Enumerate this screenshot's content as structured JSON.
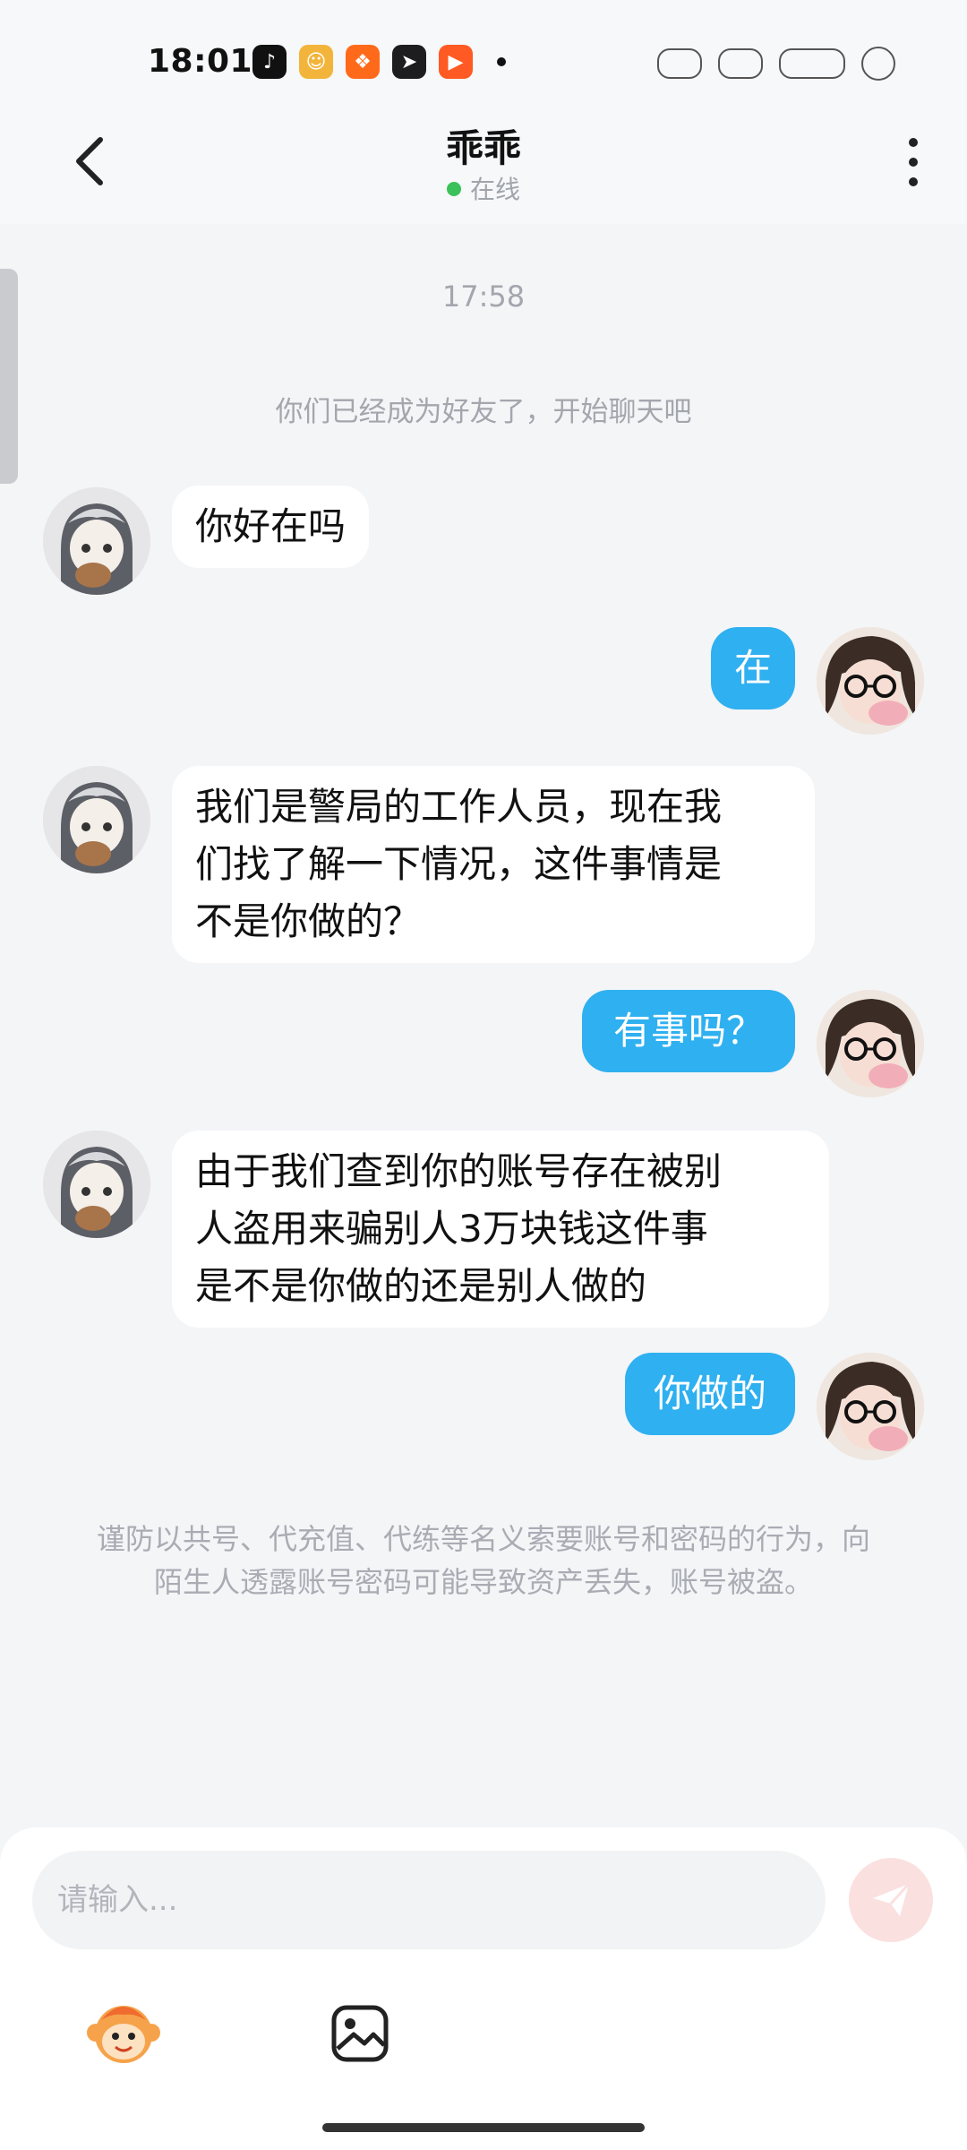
{
  "status_bar": {
    "time": "18:01",
    "apps": [
      {
        "icon": "tiktok-icon",
        "color": "#111111",
        "glyph": "♪"
      },
      {
        "icon": "game-icon",
        "color": "#f2b43a",
        "glyph": "☺"
      },
      {
        "icon": "kuaishou-icon",
        "color": "#ff6a1a",
        "glyph": "❖"
      },
      {
        "icon": "arrow-app-icon",
        "color": "#1d1d1f",
        "glyph": "➤"
      },
      {
        "icon": "video-app-icon",
        "color": "#ff5a24",
        "glyph": "▶"
      }
    ]
  },
  "header": {
    "title": "乖乖",
    "status": "在线",
    "status_color": "#3bc15a"
  },
  "chat": {
    "timestamp": "17:58",
    "system_notice": "你们已经成为好友了，开始聊天吧",
    "messages": [
      {
        "side": "left",
        "text": "你好在吗"
      },
      {
        "side": "right",
        "text": "在"
      },
      {
        "side": "left",
        "text": "我们是警局的工作人员，现在我\n们找了解一下情况，这件事情是\n不是你做的？"
      },
      {
        "side": "right",
        "text": "有事吗？"
      },
      {
        "side": "left",
        "text": "由于我们查到你的账号存在被别\n人盗用来骗别人3万块钱这件事\n是不是你做的还是别人做的"
      },
      {
        "side": "right",
        "text": "你做的"
      }
    ],
    "warning": "谨防以共号、代充值、代练等名义索要账号和密码的行为，向陌生人透露账号密码可能导致资产丢失，账号被盗。"
  },
  "composer": {
    "placeholder": "请输入...",
    "send_color": "#f07a7a"
  },
  "colors": {
    "outgoing_bubble": "#2fb0f0",
    "incoming_bubble": "#ffffff",
    "background": "#f4f5f7"
  }
}
